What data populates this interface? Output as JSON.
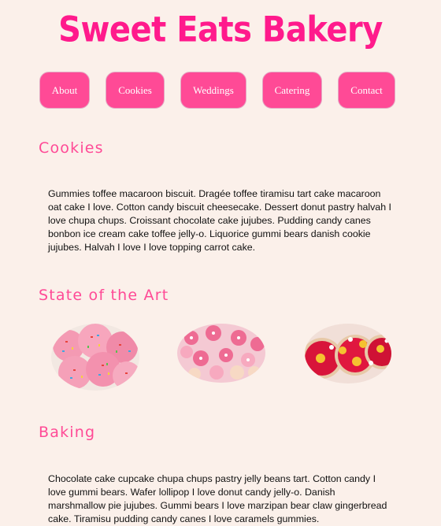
{
  "header": {
    "title": "Sweet Eats Bakery"
  },
  "nav": {
    "items": [
      {
        "label": "About"
      },
      {
        "label": "Cookies"
      },
      {
        "label": "Weddings"
      },
      {
        "label": "Catering"
      },
      {
        "label": "Contact"
      }
    ]
  },
  "sections": {
    "cookies": {
      "heading": "Cookies",
      "text": "Gummies toffee macaroon biscuit. Dragée toffee tiramisu tart cake macaroon oat cake I love. Cotton candy biscuit cheesecake. Dessert donut pastry halvah I love chupa chups. Croissant chocolate cake jujubes. Pudding candy canes bonbon ice cream cake toffee jelly-o. Liquorice gummi bears danish cookie jujubes. Halvah I love I love topping carrot cake."
    },
    "art": {
      "heading": "State of the Art"
    },
    "baking": {
      "heading": "Baking",
      "text": "Chocolate cake cupcake chupa chups pastry jelly beans tart. Cotton candy I love gummi bears. Wafer lollipop I love donut candy jelly-o. Danish marshmallow pie jujubes. Gummi bears I love marzipan bear claw gingerbread cake. Tiramisu pudding candy canes I love caramels gummies."
    }
  },
  "colors": {
    "background": "#fbf0ea",
    "title": "#ff1a8c",
    "accent": "#ff4a96",
    "text": "#111111"
  }
}
